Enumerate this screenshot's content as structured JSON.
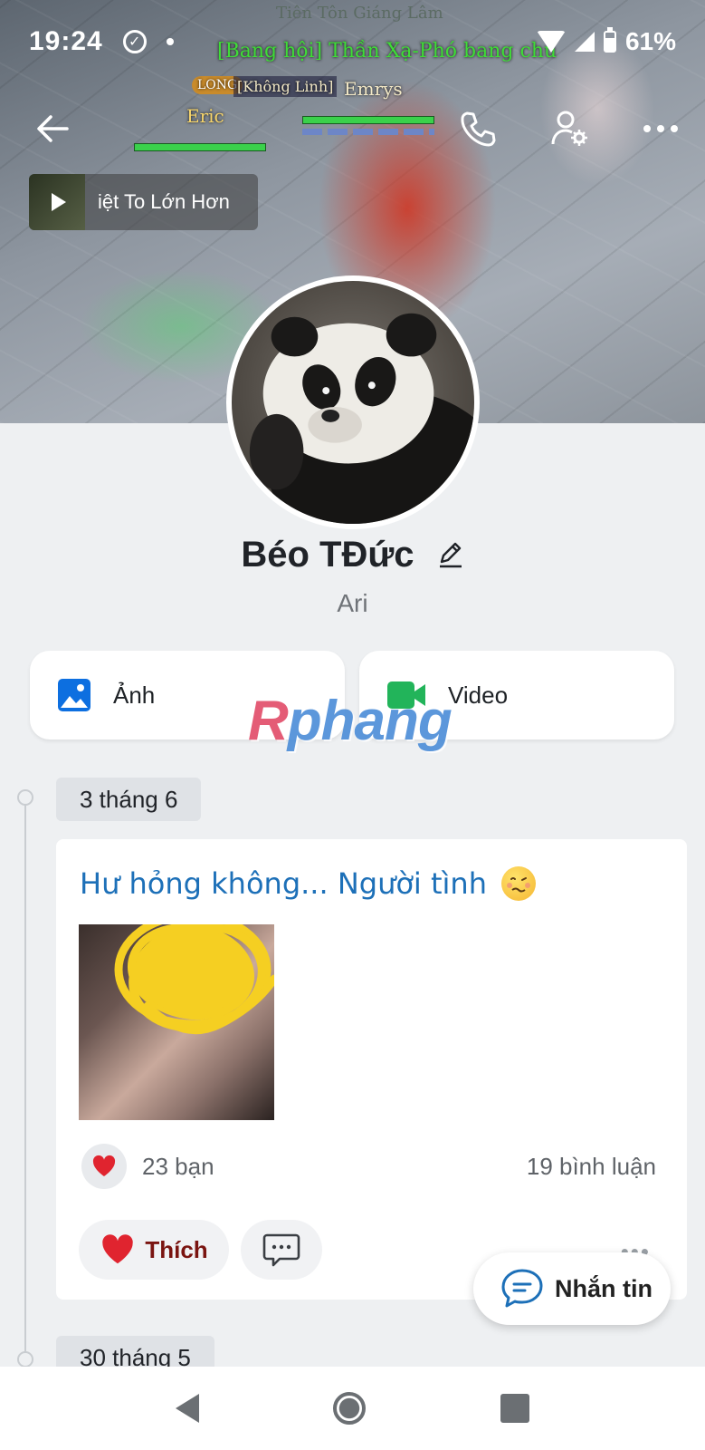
{
  "status_bar": {
    "time": "19:24",
    "battery": "61%"
  },
  "cover": {
    "game_title": "Tiên Tôn Giáng Lâm",
    "guild_text": "[Bang hội] Thần Xạ-Phó bang chủ",
    "name_left": "Eric",
    "name_tag": "[Không Linh]",
    "name_right": "Emrys",
    "badge": "LONG"
  },
  "header": {
    "back_icon": "arrow-left-icon",
    "call_icon": "phone-icon",
    "settings_icon": "user-settings-icon",
    "more_icon": "more-horizontal-icon"
  },
  "music": {
    "title": "iệt To Lớn Hơn"
  },
  "profile": {
    "name": "Béo TĐức",
    "subtitle": "Ari"
  },
  "tiles": [
    {
      "label": "Ảnh",
      "icon": "image-icon",
      "color": "#0d6fe0"
    },
    {
      "label": "Video",
      "icon": "video-camera-icon",
      "color": "#22b45a"
    }
  ],
  "watermark": {
    "part1": "R",
    "part2": "phang"
  },
  "timeline": [
    {
      "date": "3 tháng 6",
      "post_text": "Hư hỏng không... Người tình",
      "likes": "23 bạn",
      "comments": "19 bình luận",
      "like_label": "Thích",
      "more": "•••"
    },
    {
      "date": "30 tháng 5"
    }
  ],
  "fab": {
    "label": "Nhắn tin"
  },
  "colors": {
    "accent": "#0d6fe0",
    "post_text": "#1d70b8",
    "heart": "#e0242f"
  }
}
